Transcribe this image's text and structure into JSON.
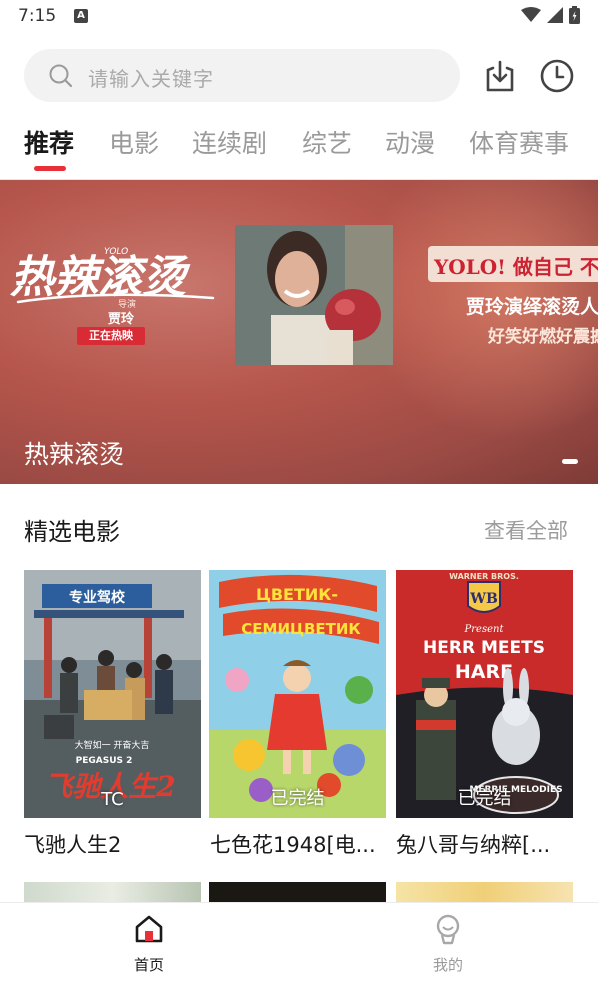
{
  "status": {
    "time": "7:15",
    "notification": "A"
  },
  "search": {
    "placeholder": "请输入关键字"
  },
  "tabs": [
    {
      "label": "推荐",
      "active": true
    },
    {
      "label": "电影"
    },
    {
      "label": "连续剧"
    },
    {
      "label": "综艺"
    },
    {
      "label": "动漫"
    },
    {
      "label": "体育赛事"
    }
  ],
  "banner": {
    "logo_text": "热辣滚烫",
    "logo_sub": "YOLO",
    "director_label": "导演",
    "director": "贾玲",
    "now_showing": "正在热映",
    "headline": "YOLO! 做自己 不",
    "line1": "贾玲演绎滚烫人",
    "line2": "好笑好燃好震撼",
    "caption": "热辣滚烫"
  },
  "section": {
    "title": "精选电影",
    "more": "查看全部"
  },
  "movies": [
    {
      "title": "飞驰人生2",
      "badge": "TC",
      "poster_sign": "专业驾校",
      "poster_tag": "PEGASUS 2",
      "poster_slogan": "大智如一 开奋大吉",
      "poster_logo": "飞驰人生2"
    },
    {
      "title": "七色花1948[电...",
      "badge": "已完结",
      "poster_heading1": "ЦВЕТИК-",
      "poster_heading2": "СЕМИЦВЕТИК"
    },
    {
      "title": "兔八哥与纳粹[...",
      "badge": "已完结",
      "poster_studio": "WARNER BROS.",
      "poster_present": "Present",
      "poster_heading1": "HERR MEETS",
      "poster_heading2": "HARE",
      "poster_series": "MERRIE MELODIES"
    }
  ],
  "nav": [
    {
      "label": "首页",
      "active": true
    },
    {
      "label": "我的"
    }
  ],
  "colors": {
    "accent": "#e8303a",
    "active_tab": "#1a1a1a",
    "inactive_tab": "#9a9a9a"
  }
}
